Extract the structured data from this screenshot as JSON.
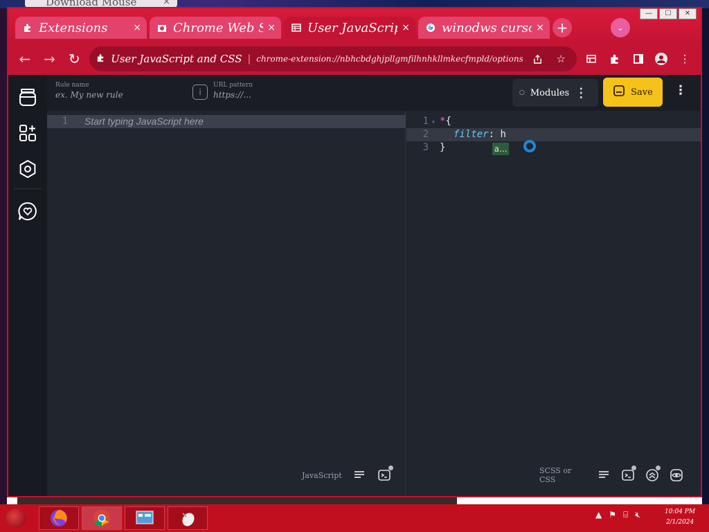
{
  "background_tab": {
    "title": "Download Mouse",
    "close": "×"
  },
  "window_controls": {
    "minimize": "—",
    "maximize": "☐",
    "close": "✕"
  },
  "tabs": [
    {
      "title": "Extensions",
      "icon": "puzzle-icon",
      "close": "×"
    },
    {
      "title": "Chrome Web Store",
      "icon": "webstore-icon",
      "close": "×"
    },
    {
      "title": "User JavaScript and CSS",
      "icon": "table-icon",
      "close": "×"
    },
    {
      "title": "winodws cursor",
      "icon": "google-icon",
      "close": "×"
    }
  ],
  "new_tab": "+",
  "tab_search": "⌄",
  "omnibox": {
    "ext_name": "User JavaScript and CSS",
    "separator": "|",
    "url": "chrome-extension://nbhcbdghjpllgmfilhnhkllmkecfmpld/options.html#settings"
  },
  "header": {
    "rule_name_label": "Rule name",
    "rule_name_placeholder": "ex. My new rule",
    "url_pattern_label": "URL pattern",
    "url_pattern_placeholder": "https://...",
    "info": "i",
    "modules_label": "Modules",
    "save_label": "Save",
    "kebab": "⋮"
  },
  "js_editor": {
    "line_number": "1",
    "placeholder": "Start typing JavaScript here",
    "footer_label": "JavaScript"
  },
  "css_editor": {
    "lines": [
      {
        "num": "1",
        "selector": "*",
        "punc": "{"
      },
      {
        "num": "2",
        "prop": "filter",
        "colon": ": ",
        "value": "h"
      },
      {
        "num": "3",
        "punc": "}"
      }
    ],
    "autocomplete": "a...",
    "footer_label": "SCSS or CSS"
  },
  "taskbar": {
    "clock_time": "10:04 PM",
    "clock_date": "2/1/2024"
  },
  "colors": {
    "accent_red": "#c41434",
    "save_yellow": "#f5c21a",
    "editor_bg": "#21252e"
  }
}
